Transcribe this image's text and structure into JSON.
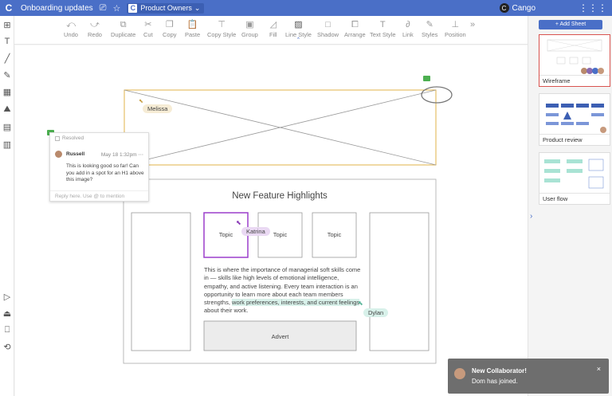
{
  "topbar": {
    "logo": "C",
    "title": "Onboarding updates",
    "icons": [
      "present-icon",
      "star-icon"
    ],
    "team_logo": "C",
    "team": "Product Owners",
    "team_caret": "⌄",
    "user_initial": "C",
    "user": "Cango",
    "grid_glyph": "⋮⋮⋮"
  },
  "toolbar": {
    "items": [
      {
        "label": "Undo",
        "glyph": "⤺"
      },
      {
        "label": "Redo",
        "glyph": "⤻"
      },
      {
        "label": "Duplicate",
        "glyph": "⧉"
      },
      {
        "label": "Cut",
        "glyph": "✂"
      },
      {
        "label": "Copy",
        "glyph": "❐"
      },
      {
        "label": "Paste",
        "glyph": "📋"
      },
      {
        "label": "Copy Style",
        "glyph": "⊤"
      },
      {
        "label": "Group",
        "glyph": "▣"
      },
      {
        "label": "Fill",
        "glyph": "◿"
      },
      {
        "label": "Line Style",
        "glyph": "▨"
      },
      {
        "label": "Shadow",
        "glyph": "□"
      },
      {
        "label": "Arrange",
        "glyph": "⧠"
      },
      {
        "label": "Text Style",
        "glyph": "T"
      },
      {
        "label": "Link",
        "glyph": "∂"
      },
      {
        "label": "Styles",
        "glyph": "✎"
      },
      {
        "label": "Position",
        "glyph": "⊥"
      }
    ],
    "more": "»"
  },
  "leftbar": {
    "top_tools": [
      "⊞",
      "T",
      "╱",
      "✎",
      "▦",
      "⛰",
      "▤",
      "▥"
    ],
    "bottom_tools": [
      "▷",
      "⏏",
      "⎕",
      "⟲"
    ],
    "expand": "›"
  },
  "canvas": {
    "presence_label": "Melissa",
    "wireframe_title": "New Feature Highlights",
    "topics": [
      "Topic",
      "Topic",
      "Topic"
    ],
    "body_text_start": "This is where the importance of managerial soft skills come in — skills like high levels of emotional intelligence, empathy, and active listening. Every team interaction is an opportunity to learn more about each team members strengths, ",
    "body_text_highlight": "work preferences, interests, and current feelings",
    "body_text_end": " about their work.",
    "advert": "Advert",
    "cursor_katrina": "Katrina",
    "cursor_dylan": "Dylan"
  },
  "comment": {
    "resolved": "Resolved",
    "author": "Russell",
    "date": "May 18 1:32pm",
    "more": "⋯",
    "text": "This is looking good so far! Can you add in a spot for an H1 above this image?",
    "reply_placeholder": "Reply here. Use @ to mention"
  },
  "right_panel": {
    "add_sheet": "+ Add Sheet",
    "sheets": [
      {
        "label": "Wireframe",
        "active": true
      },
      {
        "label": "Product review",
        "active": false
      },
      {
        "label": "User flow",
        "active": false
      }
    ],
    "expand": "›"
  },
  "toast": {
    "title": "New Collaborator!",
    "message": "Dom has joined.",
    "close": "×"
  },
  "colors": {
    "brand": "#4a6fc7",
    "selection_orange": "#e0b34a",
    "selection_purple": "#9b3fcc",
    "comment_green": "#4caf50",
    "highlight_teal": "#d8f1ea",
    "active_sheet_border": "#d9534f"
  }
}
